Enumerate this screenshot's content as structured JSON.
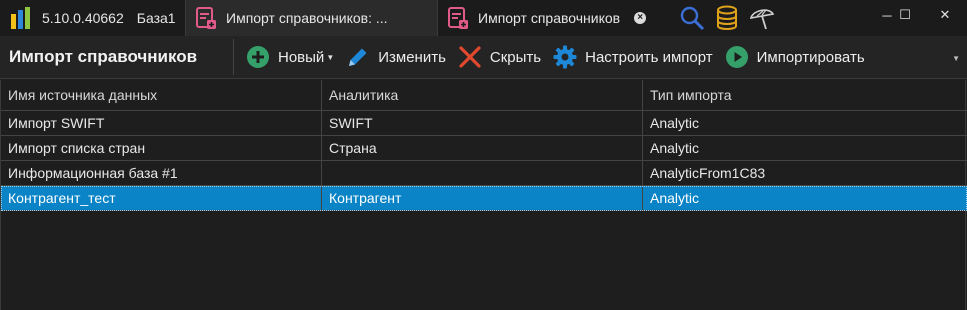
{
  "app": {
    "version": "5.10.0.40662",
    "base": "База1"
  },
  "tabs": [
    {
      "label": "Импорт справочников: ...",
      "active": false
    },
    {
      "label": "Импорт справочников",
      "active": true
    }
  ],
  "toolbar": {
    "title": "Импорт справочников",
    "new_label": "Новый",
    "edit_label": "Изменить",
    "hide_label": "Скрыть",
    "configure_label": "Настроить импорт",
    "import_label": "Импортировать"
  },
  "colors": {
    "accent_green": "#35a06a",
    "accent_blue": "#1e88d8",
    "danger": "#e0492d",
    "selection": "#0a84c6",
    "tab_pink": "#e05a8a"
  },
  "grid": {
    "columns": [
      "Имя источника данных",
      "Аналитика",
      "Тип импорта"
    ],
    "rows": [
      [
        "Импорт SWIFT",
        "SWIFT",
        "Analytic"
      ],
      [
        "Импорт списка стран",
        "Страна",
        "Analytic"
      ],
      [
        "Информационная база #1",
        "",
        "AnalyticFrom1C83"
      ],
      [
        "Контрагент_тест",
        "Контрагент",
        "Analytic"
      ]
    ],
    "selected_row": 3
  }
}
